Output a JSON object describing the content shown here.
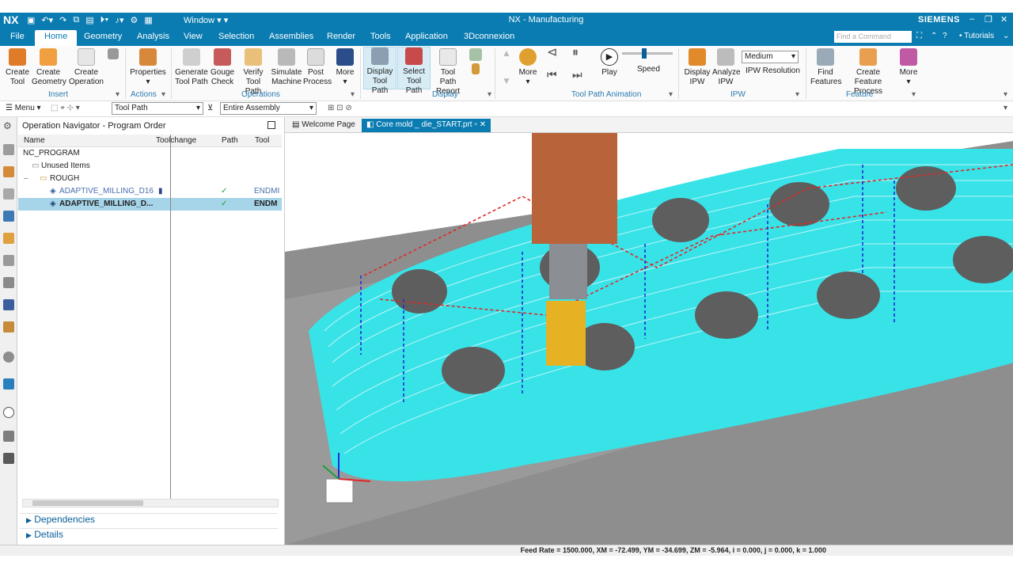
{
  "titlebar": {
    "logo": "NX",
    "window_menu": "Window",
    "title": "NX - Manufacturing",
    "brand": "SIEMENS"
  },
  "menubar": {
    "tabs": [
      "File",
      "Home",
      "Geometry",
      "Analysis",
      "View",
      "Selection",
      "Assemblies",
      "Render",
      "Tools",
      "Application",
      "3Dconnexion"
    ],
    "search_placeholder": "Find a Command",
    "tutorials": "Tutorials"
  },
  "ribbon": {
    "insert": {
      "create_tool": "Create Tool",
      "create_geometry": "Create Geometry",
      "create_operation": "Create Operation",
      "label": "Insert"
    },
    "actions": {
      "properties": "Properties",
      "label": "Actions"
    },
    "operations": {
      "generate": "Generate Tool Path",
      "gouge": "Gouge Check",
      "verify": "Verify Tool Path",
      "simulate": "Simulate Machine",
      "post": "Post Process",
      "more": "More",
      "label": "Operations"
    },
    "display": {
      "display_tool_path": "Display Tool Path",
      "select_tool_path": "Select Tool Path",
      "report": "Tool Path Report",
      "label": "Display"
    },
    "animation": {
      "more": "More",
      "play": "Play",
      "speed": "Speed",
      "label": "Tool Path Animation"
    },
    "ipw": {
      "display": "Display IPW",
      "analyze": "Analyze IPW",
      "resolution_value": "Medium",
      "resolution": "IPW Resolution",
      "label": "IPW"
    },
    "feature": {
      "find": "Find Features",
      "create": "Create Feature Process",
      "more": "More",
      "label": "Feature"
    }
  },
  "toolbar2": {
    "menu": "Menu",
    "filter": "Tool Path",
    "scope": "Entire Assembly"
  },
  "navigator": {
    "title": "Operation Navigator - Program Order",
    "columns": [
      "Name",
      "Toolchange",
      "Path",
      "Tool"
    ],
    "rows": [
      {
        "name": "NC_PROGRAM",
        "tool": ""
      },
      {
        "name": "Unused Items",
        "tool": ""
      },
      {
        "name": "ROUGH",
        "tool": ""
      },
      {
        "name": "ADAPTIVE_MILLING_D16",
        "tool": "ENDMI"
      },
      {
        "name": "ADAPTIVE_MILLING_D...",
        "tool": "ENDM"
      }
    ],
    "dependencies": "Dependencies",
    "details": "Details"
  },
  "viewport": {
    "tabs": [
      "Welcome Page",
      "Core mold _ die_START.prt"
    ]
  },
  "status": "Feed Rate = 1500.000, XM = -72.499, YM = -34.699, ZM = -5.964, i = 0.000, j = 0.000, k = 1.000",
  "colors": {
    "accent": "#0a7cb1",
    "toolpath": "#38e3e8",
    "part": "#7a7a7a"
  }
}
